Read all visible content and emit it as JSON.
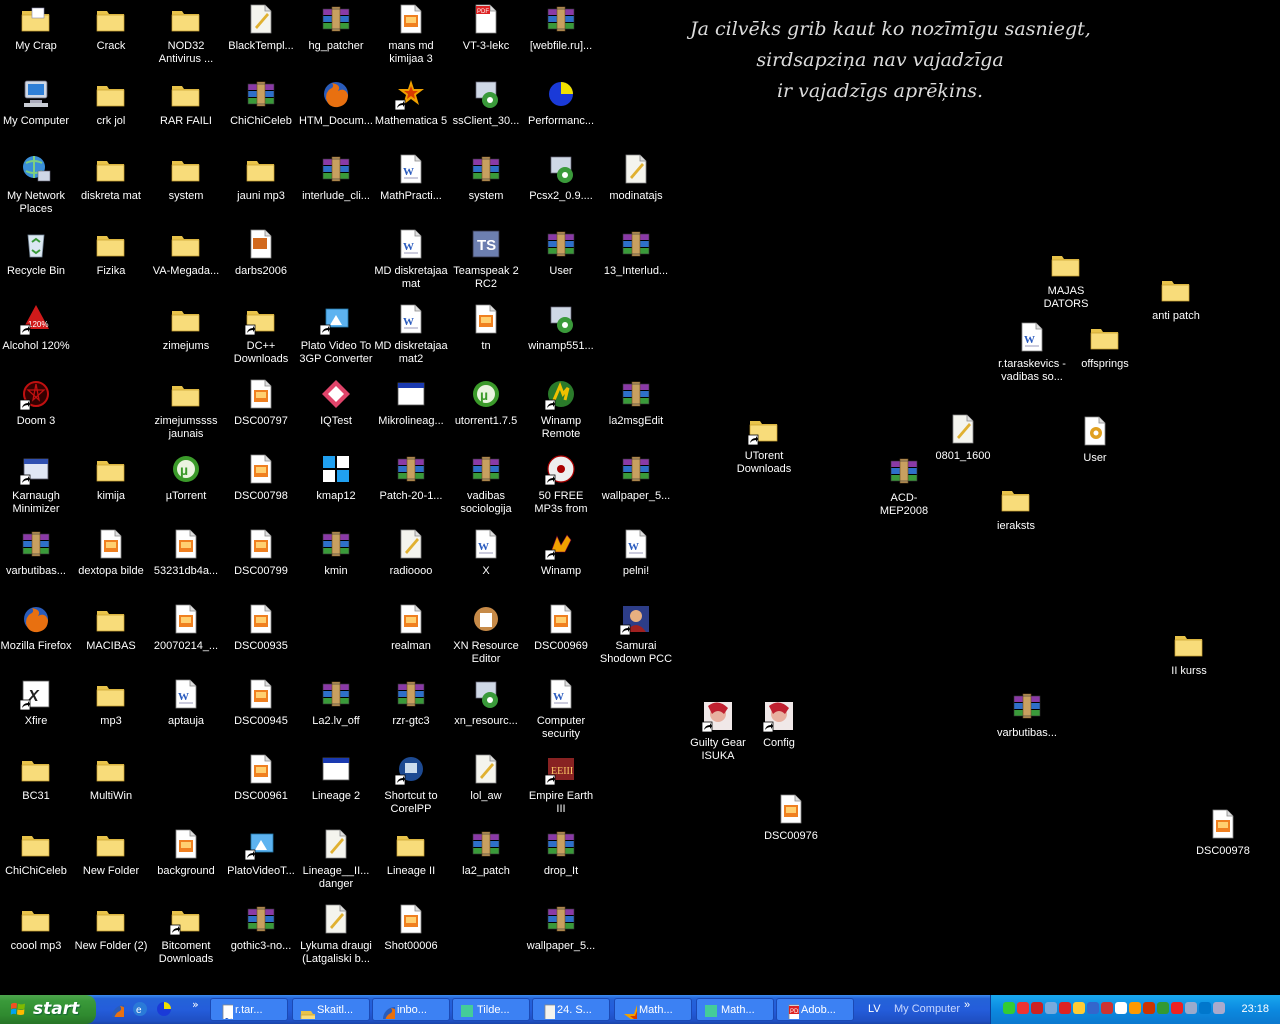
{
  "wallpaper_quote": [
    "Ja cilvēks grib kaut ko nozīmīgu sasniegt,",
    "sirdsapziņa nav vajadzīga",
    "ir vajadzīgs aprēķins."
  ],
  "icons": [
    {
      "label": "My Crap",
      "icon": "folder-docs-icon"
    },
    {
      "label": "Crack",
      "icon": "folder-icon"
    },
    {
      "label": "NOD32 Antivirus ...",
      "icon": "folder-icon"
    },
    {
      "label": "BlackTempl...",
      "icon": "file-icon"
    },
    {
      "label": "hg_patcher",
      "icon": "winrar-icon"
    },
    {
      "label": "mans md kimijaa 3",
      "icon": "image-file-icon"
    },
    {
      "label": "VT-3-lekc",
      "icon": "pdf-icon"
    },
    {
      "label": "[webfile.ru]...",
      "icon": "winrar-icon"
    },
    {
      "label": "My Computer",
      "icon": "computer-icon"
    },
    {
      "label": "crk jol",
      "icon": "folder-icon"
    },
    {
      "label": "RAR FAILI",
      "icon": "folder-icon"
    },
    {
      "label": "ChiChiCeleb",
      "icon": "winrar-icon"
    },
    {
      "label": "HTM_Docum...",
      "icon": "firefox-icon"
    },
    {
      "label": "Mathematica 5",
      "icon": "mathematica-icon"
    },
    {
      "label": "ssClient_30...",
      "icon": "installer-icon"
    },
    {
      "label": "Performanc...",
      "icon": "pie-icon"
    },
    {
      "label": "My Network Places",
      "icon": "network-icon"
    },
    {
      "label": "diskreta mat",
      "icon": "folder-icon"
    },
    {
      "label": "system",
      "icon": "folder-icon"
    },
    {
      "label": "jauni mp3",
      "icon": "folder-icon"
    },
    {
      "label": "interlude_cli...",
      "icon": "winrar-icon"
    },
    {
      "label": "MathPracti...",
      "icon": "word-icon"
    },
    {
      "label": "system",
      "icon": "winrar-icon"
    },
    {
      "label": "Pcsx2_0.9....",
      "icon": "installer-icon"
    },
    {
      "label": "modinatajs",
      "icon": "file-icon"
    },
    {
      "label": "Recycle Bin",
      "icon": "recycle-bin-icon"
    },
    {
      "label": "Fizika",
      "icon": "folder-icon"
    },
    {
      "label": "VA-Megada...",
      "icon": "folder-icon"
    },
    {
      "label": "darbs2006",
      "icon": "powerpoint-icon"
    },
    {
      "label": "MD diskretajaa mat",
      "icon": "word-icon"
    },
    {
      "label": "Teamspeak 2 RC2",
      "icon": "teamspeak-icon"
    },
    {
      "label": "User",
      "icon": "winrar-icon"
    },
    {
      "label": "13_Interlud...",
      "icon": "winrar-icon"
    },
    {
      "label": "Alcohol 120%",
      "icon": "alcohol-icon"
    },
    {
      "label": "zimejums",
      "icon": "folder-icon"
    },
    {
      "label": "DC++ Downloads",
      "icon": "folder-shortcut-icon"
    },
    {
      "label": "Plato Video To 3GP Converter",
      "icon": "plato-icon"
    },
    {
      "label": "MD diskretajaa mat2",
      "icon": "word-icon"
    },
    {
      "label": "tn",
      "icon": "image-file-icon"
    },
    {
      "label": "winamp551...",
      "icon": "installer-icon"
    },
    {
      "label": "Doom 3",
      "icon": "doom-icon"
    },
    {
      "label": "zimejumssss jaunais",
      "icon": "folder-icon"
    },
    {
      "label": "DSC00797",
      "icon": "image-file-icon"
    },
    {
      "label": "IQTest",
      "icon": "iqtest-icon"
    },
    {
      "label": "Mikrolineag...",
      "icon": "window-icon"
    },
    {
      "label": "utorrent1.7.5",
      "icon": "utorrent-icon"
    },
    {
      "label": "Winamp Remote",
      "icon": "winamp-remote-icon"
    },
    {
      "label": "la2msgEdit",
      "icon": "winrar-icon"
    },
    {
      "label": "Karnaugh Minimizer",
      "icon": "app-shortcut-icon"
    },
    {
      "label": "kimija",
      "icon": "folder-icon"
    },
    {
      "label": "µTorrent",
      "icon": "utorrent-icon"
    },
    {
      "label": "DSC00798",
      "icon": "image-file-icon"
    },
    {
      "label": "kmap12",
      "icon": "kmap-icon"
    },
    {
      "label": "Patch-20-1...",
      "icon": "winrar-icon"
    },
    {
      "label": "vadibas sociologija",
      "icon": "winrar-icon"
    },
    {
      "label": "50 FREE MP3s from eMusic!",
      "icon": "emusic-icon"
    },
    {
      "label": "wallpaper_5...",
      "icon": "winrar-icon"
    },
    {
      "label": "varbutibas...",
      "icon": "winrar-icon"
    },
    {
      "label": "dextopa bilde",
      "icon": "image-file-icon"
    },
    {
      "label": "53231db4a...",
      "icon": "image-file-icon"
    },
    {
      "label": "DSC00799",
      "icon": "image-file-icon"
    },
    {
      "label": "kmin",
      "icon": "winrar-icon"
    },
    {
      "label": "radioooo",
      "icon": "file-icon"
    },
    {
      "label": "X",
      "icon": "word-icon"
    },
    {
      "label": "Winamp",
      "icon": "winamp-icon"
    },
    {
      "label": "pelni!",
      "icon": "word-icon"
    },
    {
      "label": "Mozilla Firefox",
      "icon": "firefox-icon"
    },
    {
      "label": "MACIBAS",
      "icon": "folder-icon"
    },
    {
      "label": "20070214_...",
      "icon": "image-file-icon"
    },
    {
      "label": "DSC00935",
      "icon": "image-file-icon"
    },
    {
      "label": "realman",
      "icon": "image-file-icon"
    },
    {
      "label": "XN Resource Editor",
      "icon": "xn-icon"
    },
    {
      "label": "DSC00969",
      "icon": "image-file-icon"
    },
    {
      "label": "Samurai Shodown PCC",
      "icon": "samurai-icon"
    },
    {
      "label": "Xfire",
      "icon": "xfire-icon"
    },
    {
      "label": "mp3",
      "icon": "folder-icon"
    },
    {
      "label": "aptauja",
      "icon": "word-icon"
    },
    {
      "label": "DSC00945",
      "icon": "image-file-icon"
    },
    {
      "label": "La2.lv_off",
      "icon": "winrar-icon"
    },
    {
      "label": "rzr-gtc3",
      "icon": "winrar-icon"
    },
    {
      "label": "xn_resourc...",
      "icon": "installer-icon"
    },
    {
      "label": "Computer security",
      "icon": "word-icon"
    },
    {
      "label": "BC31",
      "icon": "folder-icon"
    },
    {
      "label": "MultiWin",
      "icon": "folder-icon"
    },
    {
      "label": "DSC00961",
      "icon": "image-file-icon"
    },
    {
      "label": "Lineage 2",
      "icon": "window-icon"
    },
    {
      "label": "Shortcut to CorelPP",
      "icon": "corel-icon"
    },
    {
      "label": "lol_aw",
      "icon": "file-icon"
    },
    {
      "label": "Empire Earth III",
      "icon": "empire-icon"
    },
    {
      "label": "ChiChiCeleb",
      "icon": "folder-icon"
    },
    {
      "label": "New Folder",
      "icon": "folder-icon"
    },
    {
      "label": "background",
      "icon": "image-file-icon"
    },
    {
      "label": "PlatoVideoT...",
      "icon": "plato-icon"
    },
    {
      "label": "Lineage__II... danger",
      "icon": "file-icon"
    },
    {
      "label": "Lineage II",
      "icon": "folder-icon"
    },
    {
      "label": "la2_patch",
      "icon": "winrar-icon"
    },
    {
      "label": "drop_It",
      "icon": "winrar-icon"
    },
    {
      "label": "coool mp3",
      "icon": "folder-icon"
    },
    {
      "label": "New Folder (2)",
      "icon": "folder-icon"
    },
    {
      "label": "Bitcoment Downloads",
      "icon": "folder-shortcut-icon"
    },
    {
      "label": "gothic3-no...",
      "icon": "winrar-icon"
    },
    {
      "label": "Lykuma draugi (Latgaliski b...",
      "icon": "file-icon"
    },
    {
      "label": "Shot00006",
      "icon": "image-file-icon"
    },
    {
      "label": "wallpaper_5...",
      "icon": "winrar-icon"
    },
    {
      "label": "MAJAS DATORS",
      "icon": "folder-icon"
    },
    {
      "label": "anti patch",
      "icon": "folder-icon"
    },
    {
      "label": "r.taraskevics - vadibas so...",
      "icon": "word-icon"
    },
    {
      "label": "offsprings",
      "icon": "folder-icon"
    },
    {
      "label": "UTorent Downloads",
      "icon": "folder-shortcut-icon"
    },
    {
      "label": "0801_1600",
      "icon": "file-icon"
    },
    {
      "label": "User",
      "icon": "settings-file-icon"
    },
    {
      "label": "ACD-MEP2008",
      "icon": "winrar-icon"
    },
    {
      "label": "ieraksts",
      "icon": "folder-icon"
    },
    {
      "label": "II kurss",
      "icon": "folder-icon"
    },
    {
      "label": "Guilty Gear ISUKA",
      "icon": "guilty-gear-icon"
    },
    {
      "label": "Config",
      "icon": "guilty-gear-icon"
    },
    {
      "label": "varbutibas...",
      "icon": "winrar-icon"
    },
    {
      "label": "DSC00976",
      "icon": "image-file-icon"
    },
    {
      "label": "DSC00978",
      "icon": "image-file-icon"
    }
  ],
  "taskbar": {
    "start_label": "start",
    "quick_launch": [
      "firefox-icon",
      "ie-icon",
      "performance-icon"
    ],
    "more_chevron": "»",
    "buttons": [
      {
        "label": "r.tar...",
        "icon": "word-icon"
      },
      {
        "label": "Skaitl...",
        "icon": "folder-icon"
      },
      {
        "label": "inbo...",
        "icon": "firefox-icon"
      },
      {
        "label": "Tilde...",
        "icon": "app-icon"
      },
      {
        "label": "24. S...",
        "icon": "file-icon"
      },
      {
        "label": "Math...",
        "icon": "mathematica-icon"
      },
      {
        "label": "Math...",
        "icon": "app-icon"
      },
      {
        "label": "Adob...",
        "icon": "pdf-icon"
      }
    ],
    "language": "LV",
    "address_label": "My Computer",
    "address_chevron": "»",
    "tray_icons": [
      "tray-1",
      "tray-2",
      "tray-3",
      "tray-4",
      "tray-5",
      "tray-6",
      "tray-7",
      "tray-8",
      "tray-9",
      "tray-10",
      "tray-11",
      "tray-12",
      "tray-13",
      "tray-14",
      "tray-15",
      "tray-16"
    ],
    "clock": "23:18",
    "colors": {
      "taskbar": "#245ddb",
      "start": "#3a9a3a",
      "tray": "#0c8ae0"
    }
  }
}
